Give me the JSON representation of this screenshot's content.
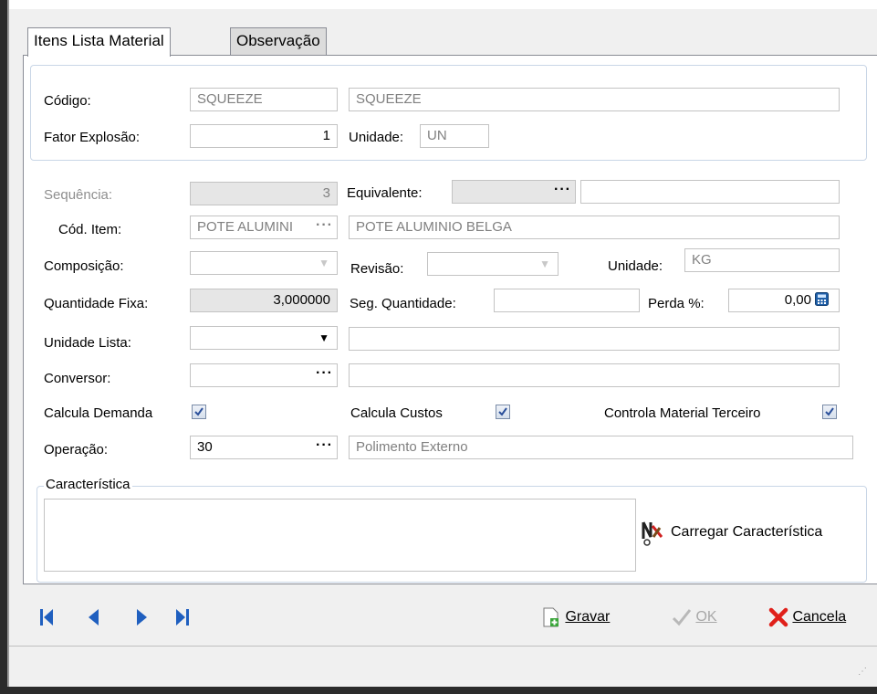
{
  "tabs": [
    {
      "label": "Itens Lista Material",
      "active": true
    },
    {
      "label": "Observação",
      "active": false
    }
  ],
  "header": {
    "codigo_label": "Código:",
    "codigo_value": "SQUEEZE",
    "codigo_desc": "SQUEEZE",
    "fator_label": "Fator Explosão:",
    "fator_value": "1",
    "unidade_label": "Unidade:",
    "unidade_value": "UN"
  },
  "form": {
    "sequencia_label": "Sequência:",
    "sequencia_value": "3",
    "equivalente_label": "Equivalente:",
    "equivalente_value": "",
    "equivalente_desc": "",
    "cod_item_label": "Cód. Item:",
    "cod_item_value": "POTE ALUMINI",
    "cod_item_desc": "POTE ALUMINIO BELGA",
    "composicao_label": "Composição:",
    "revisao_label": "Revisão:",
    "unidade_label": "Unidade:",
    "unidade_value": "KG",
    "qtd_fixa_label": "Quantidade Fixa:",
    "qtd_fixa_value": "3,000000",
    "seg_qtd_label": "Seg. Quantidade:",
    "seg_qtd_value": "",
    "perda_label": "Perda %:",
    "perda_value": "0,00",
    "unidade_lista_label": "Unidade Lista:",
    "unidade_lista_value": "",
    "conversor_label": "Conversor:",
    "conversor_value": "",
    "calcula_demanda_label": "Calcula Demanda",
    "calcula_demanda_checked": true,
    "calcula_custos_label": "Calcula Custos",
    "calcula_custos_checked": true,
    "controla_terceiro_label": "Controla Material Terceiro",
    "controla_terceiro_checked": true,
    "operacao_label": "Operação:",
    "operacao_value": "30",
    "operacao_desc": "Polimento Externo",
    "caracteristica_label": "Característica",
    "carregar_label": "Carregar Característica"
  },
  "actions": {
    "gravar": "Gravar",
    "ok": "OK",
    "cancela": "Cancela"
  },
  "ellipsis": "···",
  "colors": {
    "nav_blue": "#1f5fbf",
    "cancel_red": "#e0201a",
    "check_blue": "#2a4f9a",
    "save_green": "#3aa53a"
  }
}
